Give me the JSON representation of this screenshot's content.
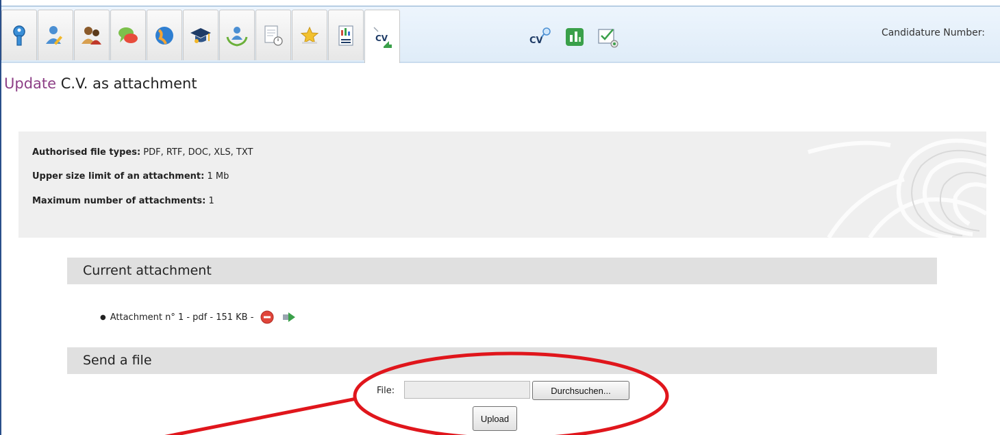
{
  "header": {
    "candidature_label": "Candidature Number:"
  },
  "tabs": [
    {
      "icon": "key-icon"
    },
    {
      "icon": "user-edit-icon"
    },
    {
      "icon": "people-icon"
    },
    {
      "icon": "speech-bubbles-icon"
    },
    {
      "icon": "globe-icon"
    },
    {
      "icon": "graduation-cap-icon"
    },
    {
      "icon": "team-laurel-icon"
    },
    {
      "icon": "document-clock-icon"
    },
    {
      "icon": "star-icon"
    },
    {
      "icon": "report-chart-icon"
    },
    {
      "icon": "cv-upload-icon",
      "label": "CV",
      "active": true
    }
  ],
  "tools": [
    {
      "icon": "cv-search-icon",
      "label": "CV"
    },
    {
      "icon": "green-chart-icon"
    },
    {
      "icon": "checklist-icon"
    }
  ],
  "page": {
    "title_accent": "Update",
    "title_rest": "C.V. as attachment"
  },
  "info": {
    "file_types_label": "Authorised file types:",
    "file_types_value": "PDF, RTF, DOC, XLS, TXT",
    "size_label": "Upper size limit of an attachment:",
    "size_value": "1 Mb",
    "max_label": "Maximum number of attachments:",
    "max_value": "1"
  },
  "current_attachment": {
    "heading": "Current attachment",
    "items": [
      {
        "text": "Attachment n° 1 - pdf - 151 KB -"
      }
    ]
  },
  "send_file": {
    "heading": "Send a file",
    "file_label": "File:",
    "file_value": "",
    "browse_label": "Durchsuchen...",
    "upload_label": "Upload"
  },
  "colors": {
    "accent": "#8d3f86",
    "annotation": "#e0161c",
    "section_bar": "#e0e0e0"
  }
}
